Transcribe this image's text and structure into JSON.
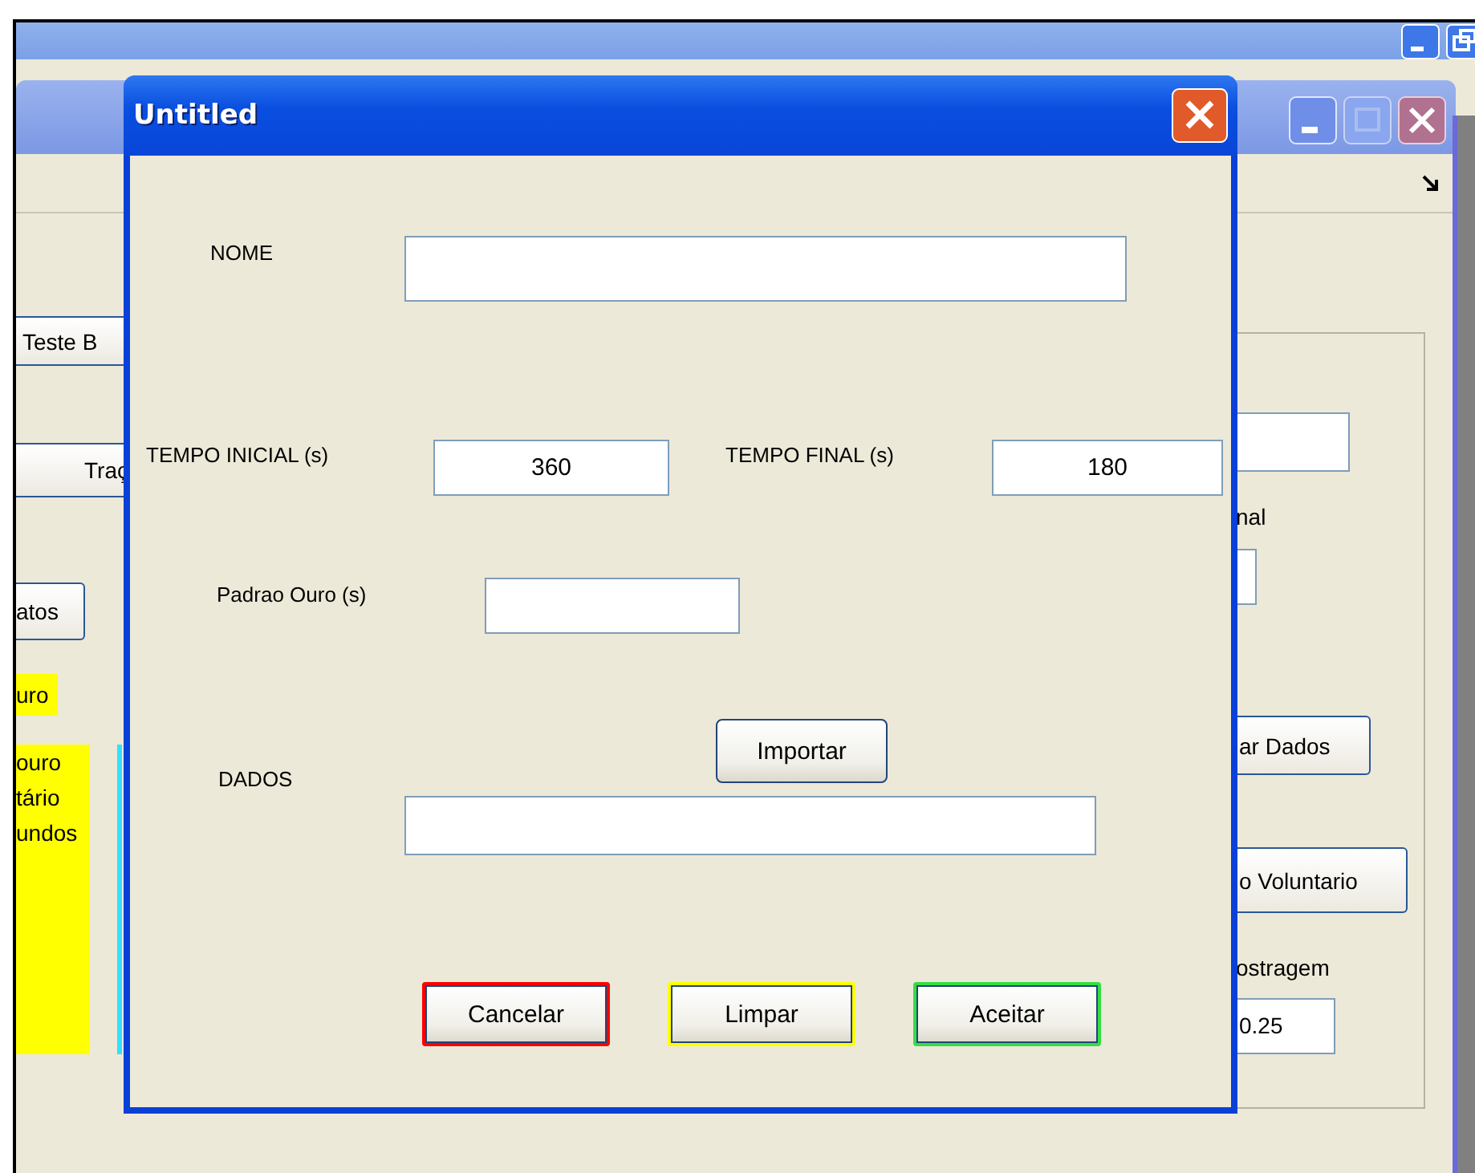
{
  "main_window": {
    "left_widgets": [
      {
        "kind": "button",
        "text": "Teste B"
      },
      {
        "kind": "button",
        "text": "Traç"
      },
      {
        "kind": "button",
        "text": "atos"
      },
      {
        "kind": "highlight",
        "text": "uro"
      },
      {
        "kind": "highlight",
        "text": "ouro\ntário\nundos"
      }
    ],
    "right_widgets": [
      {
        "kind": "field"
      },
      {
        "kind": "label",
        "text": "nal"
      },
      {
        "kind": "field"
      },
      {
        "kind": "button",
        "text": "ar Dados"
      },
      {
        "kind": "button",
        "text": "o Voluntario"
      },
      {
        "kind": "label",
        "text": "ostragem"
      },
      {
        "kind": "field",
        "text": "0.25"
      }
    ]
  },
  "dialog": {
    "title": "Untitled",
    "nome": {
      "label": "NOME"
    },
    "tempo_inicial": {
      "label": "TEMPO INICIAL (s)",
      "value": "360"
    },
    "tempo_final": {
      "label": "TEMPO FINAL (s)",
      "value": "180"
    },
    "padrao_ouro": {
      "label": "Padrao Ouro (s)"
    },
    "dados": {
      "label": "DADOS",
      "import_button": "Importar"
    },
    "buttons": [
      {
        "label": "Cancelar",
        "color": "#ff0000"
      },
      {
        "label": "Limpar",
        "color": "#ffff00"
      },
      {
        "label": "Aceitar",
        "color": "#33dd44"
      }
    ]
  }
}
